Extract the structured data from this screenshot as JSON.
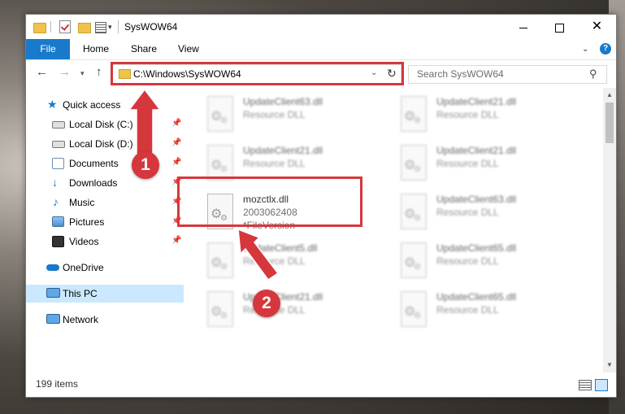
{
  "window": {
    "title": "SysWOW64"
  },
  "ribbon": {
    "tabs": [
      "File",
      "Home",
      "Share",
      "View"
    ]
  },
  "window_controls": {
    "minimize": "",
    "maximize": "",
    "close": "✕"
  },
  "address_bar": {
    "path": "C:\\Windows\\SysWOW64"
  },
  "search": {
    "placeholder": "Search SysWOW64"
  },
  "sidebar": {
    "items": [
      {
        "label": "Quick access",
        "icon": "star-icon",
        "pinned": false
      },
      {
        "label": "Local Disk (C:)",
        "icon": "drive-icon",
        "pinned": true
      },
      {
        "label": "Local Disk (D:)",
        "icon": "drive-icon",
        "pinned": true
      },
      {
        "label": "Documents",
        "icon": "documents-icon",
        "pinned": true
      },
      {
        "label": "Downloads",
        "icon": "downloads-icon",
        "pinned": true
      },
      {
        "label": "Music",
        "icon": "music-icon",
        "pinned": true
      },
      {
        "label": "Pictures",
        "icon": "pictures-icon",
        "pinned": true
      },
      {
        "label": "Videos",
        "icon": "videos-icon",
        "pinned": true
      },
      {
        "label": "OneDrive",
        "icon": "onedrive-icon",
        "pinned": false
      },
      {
        "label": "This PC",
        "icon": "pc-icon",
        "pinned": false,
        "selected": true
      },
      {
        "label": "Network",
        "icon": "network-icon",
        "pinned": false
      }
    ]
  },
  "files": [
    {
      "name": "UpdateClient63.dll",
      "type": "Resource DLL",
      "extra": "",
      "blurred": true
    },
    {
      "name": "UpdateClient21.dll",
      "type": "Resource DLL",
      "extra": "",
      "blurred": true
    },
    {
      "name": "UpdateClient21.dll",
      "type": "Resource DLL",
      "extra": "",
      "blurred": true
    },
    {
      "name": "UpdateClient21.dll",
      "type": "Resource DLL",
      "extra": "",
      "blurred": true
    },
    {
      "name": "mozctlx.dll",
      "type": "2003062408",
      "extra": "*FileVersion",
      "blurred": false,
      "highlighted": true
    },
    {
      "name": "UpdateClient63.dll",
      "type": "Resource DLL",
      "extra": "",
      "blurred": true
    },
    {
      "name": "UpdateClient5.dll",
      "type": "Resource DLL",
      "extra": "",
      "blurred": true
    },
    {
      "name": "UpdateClient65.dll",
      "type": "Resource DLL",
      "extra": "",
      "blurred": true
    },
    {
      "name": "UpdateClient21.dll",
      "type": "Resource DLL",
      "extra": "",
      "blurred": true
    },
    {
      "name": "UpdateClient65.dll",
      "type": "Resource DLL",
      "extra": "",
      "blurred": true
    }
  ],
  "status": {
    "item_count": "199 items"
  },
  "callouts": [
    "1",
    "2"
  ],
  "colors": {
    "accent": "#1979ca",
    "highlight": "#d6373c",
    "selected": "#cce8ff"
  }
}
